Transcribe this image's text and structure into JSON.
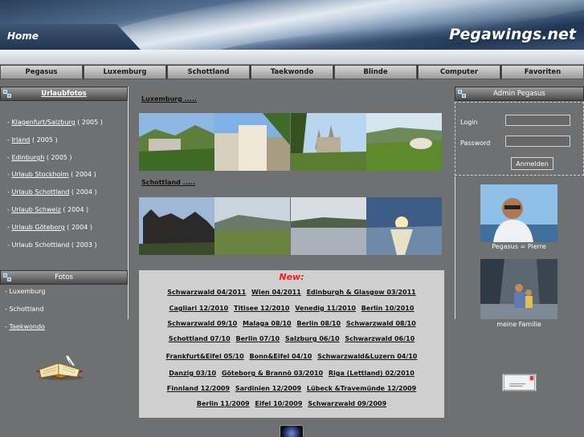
{
  "header": {
    "home_label": "Home",
    "site_title": "Pegawings.net"
  },
  "nav": [
    "Pegasus",
    "Luxemburg",
    "Schottland",
    "Taekwondo",
    "Blinde",
    "Computer",
    "Favoriten"
  ],
  "left": {
    "urlaub_title": "Urlaubfotos",
    "trips": [
      {
        "prefix": "- ",
        "link": "Klagenfurt/Salzburg",
        "suffix": " ( 2005 )"
      },
      {
        "prefix": "- ",
        "link": "Irland",
        "suffix": " ( 2005 )"
      },
      {
        "prefix": "- ",
        "link": "Edinburgh",
        "suffix": " ( 2005 )"
      },
      {
        "prefix": "- ",
        "link": "Urlaub Stockholm",
        "suffix": " ( 2004 )"
      },
      {
        "prefix": "- ",
        "link": "Urlaub Schottland",
        "suffix": " (  2004 )"
      },
      {
        "prefix": "- ",
        "link": "Urlaub Schweiz",
        "suffix": " ( 2004 )"
      },
      {
        "prefix": "- ",
        "link": "Urlaub Göteborg",
        "suffix": " ( 2004 )"
      },
      {
        "prefix": "- ",
        "link": "",
        "suffix": "Urlaub Schottland ( 2003 )"
      }
    ],
    "fotos_title": "Fotos",
    "fotos": [
      {
        "prefix": "- ",
        "text": "Luxemburg"
      },
      {
        "prefix": "- ",
        "text": "Schottland"
      },
      {
        "prefix": "- ",
        "text": "Taekwondo"
      }
    ]
  },
  "center": {
    "lux_title": "Luxemburg .....",
    "scot_title": "Schottland .....",
    "new_title": "New:",
    "new_rows": [
      [
        "Schwarzwald 04/2011",
        "Wien 04/2011",
        "Edinburgh & Glasgow 03/2011"
      ],
      [
        "Cagliari 12/2010",
        "Titisee 12/2010",
        "Venedig 11/2010",
        "Berlin 10/2010"
      ],
      [
        "Schwarzwald 09/10",
        "Malaga 08/10",
        "Berlin 08/10",
        "Schwarzwald 08/10"
      ],
      [
        "Schottland 07/10",
        "Berlin 07/10",
        "Salzburg 06/10",
        "Schwarzwald 06/10"
      ],
      [
        "Frankfurt&Eifel 05/10",
        "Bonn&Eifel 04/10",
        "Schwarzwald&Luzern 04/10"
      ],
      [
        "Danzig 03/10",
        "Göteborg & Brannö 03/2010",
        "Riga (Lettland) 02/2010"
      ],
      [
        "Finnland 12/2009",
        "Sardinien 12/2009",
        "Lübeck &Travemünde 12/2009"
      ],
      [
        "Berlin 11/2009",
        "Eifel 10/2009",
        "Schwarzwald 09/2009"
      ]
    ]
  },
  "right": {
    "admin_title": "Admin Pegasus",
    "login_label": "Login",
    "password_label": "Password",
    "login_button": "Anmelden",
    "caption_1": "Pegasus = Pierre",
    "caption_2": "meine Familie"
  },
  "colors": {
    "background": "#6f7072",
    "new_title": "#ff1a1a",
    "new_box": "#cfcfcf"
  }
}
